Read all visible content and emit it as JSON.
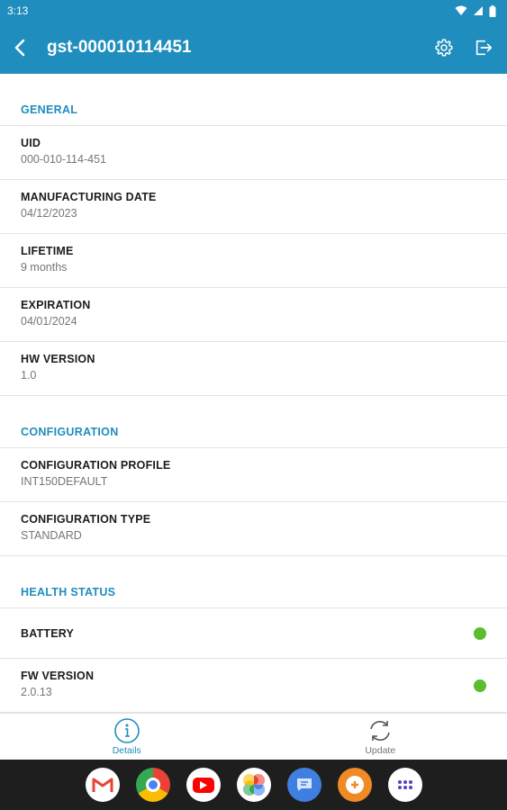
{
  "status_bar": {
    "time": "3:13"
  },
  "app_bar": {
    "title": "gst-000010114451"
  },
  "sections": [
    {
      "header": "GENERAL",
      "rows": [
        {
          "label": "UID",
          "value": "000-010-114-451"
        },
        {
          "label": "MANUFACTURING DATE",
          "value": "04/12/2023"
        },
        {
          "label": "LIFETIME",
          "value": "9 months"
        },
        {
          "label": "EXPIRATION",
          "value": "04/01/2024"
        },
        {
          "label": "HW VERSION",
          "value": "1.0"
        }
      ]
    },
    {
      "header": "CONFIGURATION",
      "rows": [
        {
          "label": "CONFIGURATION PROFILE",
          "value": "INT150DEFAULT"
        },
        {
          "label": "CONFIGURATION TYPE",
          "value": "STANDARD"
        }
      ]
    },
    {
      "header": "HEALTH STATUS",
      "rows": [
        {
          "label": "BATTERY",
          "value": "",
          "status": "ok"
        },
        {
          "label": "FW VERSION",
          "value": "2.0.13",
          "status": "ok"
        }
      ]
    }
  ],
  "bottom_nav": [
    {
      "label": "Details",
      "icon": "info-icon",
      "active": true
    },
    {
      "label": "Update",
      "icon": "sync-icon",
      "active": false
    }
  ],
  "dock": [
    "gmail-icon",
    "chrome-icon",
    "youtube-icon",
    "photos-icon",
    "messages-icon",
    "app-icon",
    "app-drawer-icon"
  ],
  "colors": {
    "accent": "#1f8dbd",
    "status_ok": "#5bbd2b"
  }
}
